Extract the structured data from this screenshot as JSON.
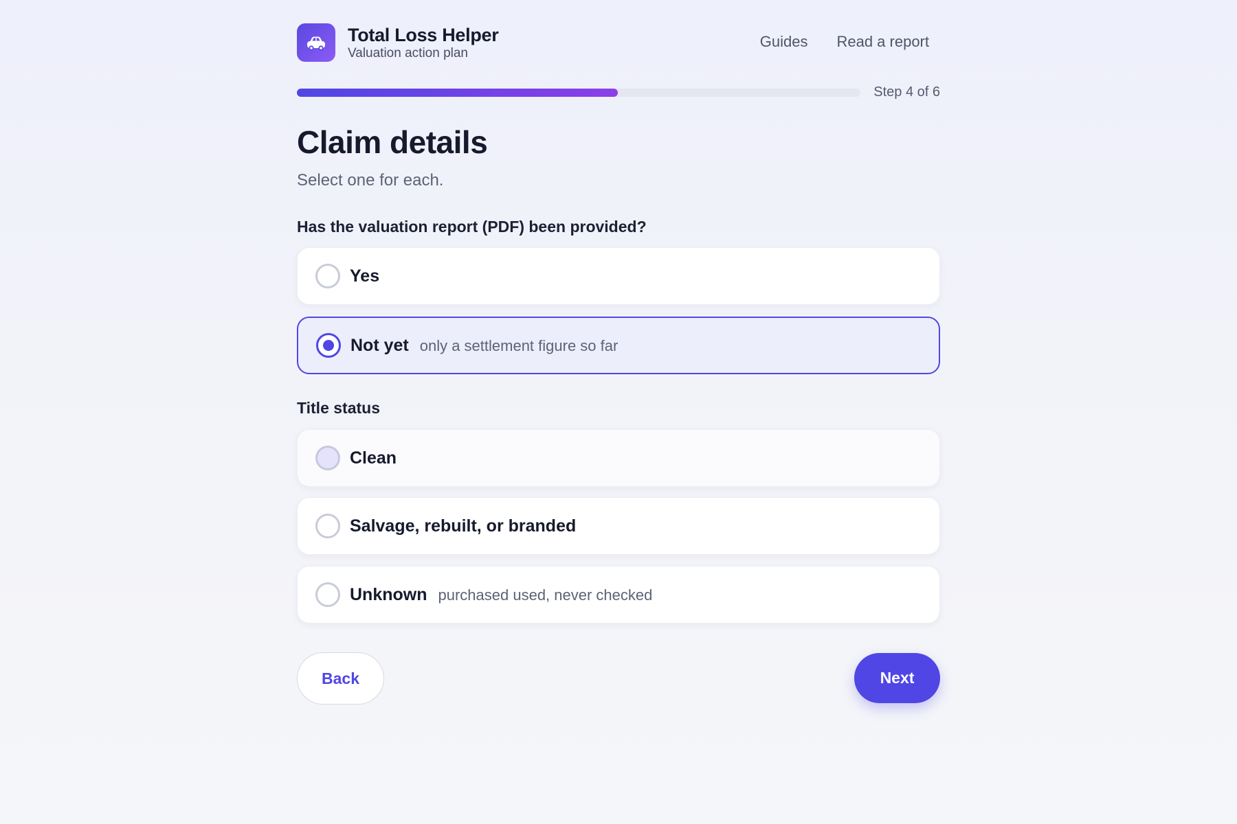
{
  "app": {
    "title": "Total Loss Helper",
    "subtitle": "Valuation action plan",
    "logo_icon": "car-icon",
    "accent_color": "#4f46e5"
  },
  "nav": {
    "items": [
      {
        "label": "Guides"
      },
      {
        "label": "Read a report"
      }
    ]
  },
  "progress": {
    "label": "Step 4 of 6",
    "current_step": 4,
    "total_steps": 6,
    "fill_fraction": 0.57
  },
  "page": {
    "title": "Claim details",
    "subtitle": "Select one for each."
  },
  "questions": [
    {
      "label": "Has the valuation report (PDF) been provided?",
      "options": [
        {
          "label": "Yes",
          "hint": "",
          "selected": false
        },
        {
          "label": "Not yet",
          "hint": "only a settlement figure so far",
          "selected": true
        }
      ]
    },
    {
      "label": "Title status",
      "options": [
        {
          "label": "Clean",
          "hint": "",
          "selected": false
        },
        {
          "label": "Salvage, rebuilt, or branded",
          "hint": "",
          "selected": false
        },
        {
          "label": "Unknown",
          "hint": "purchased used, never checked",
          "selected": false
        }
      ]
    }
  ],
  "actions": {
    "back_label": "Back",
    "next_label": "Next"
  }
}
